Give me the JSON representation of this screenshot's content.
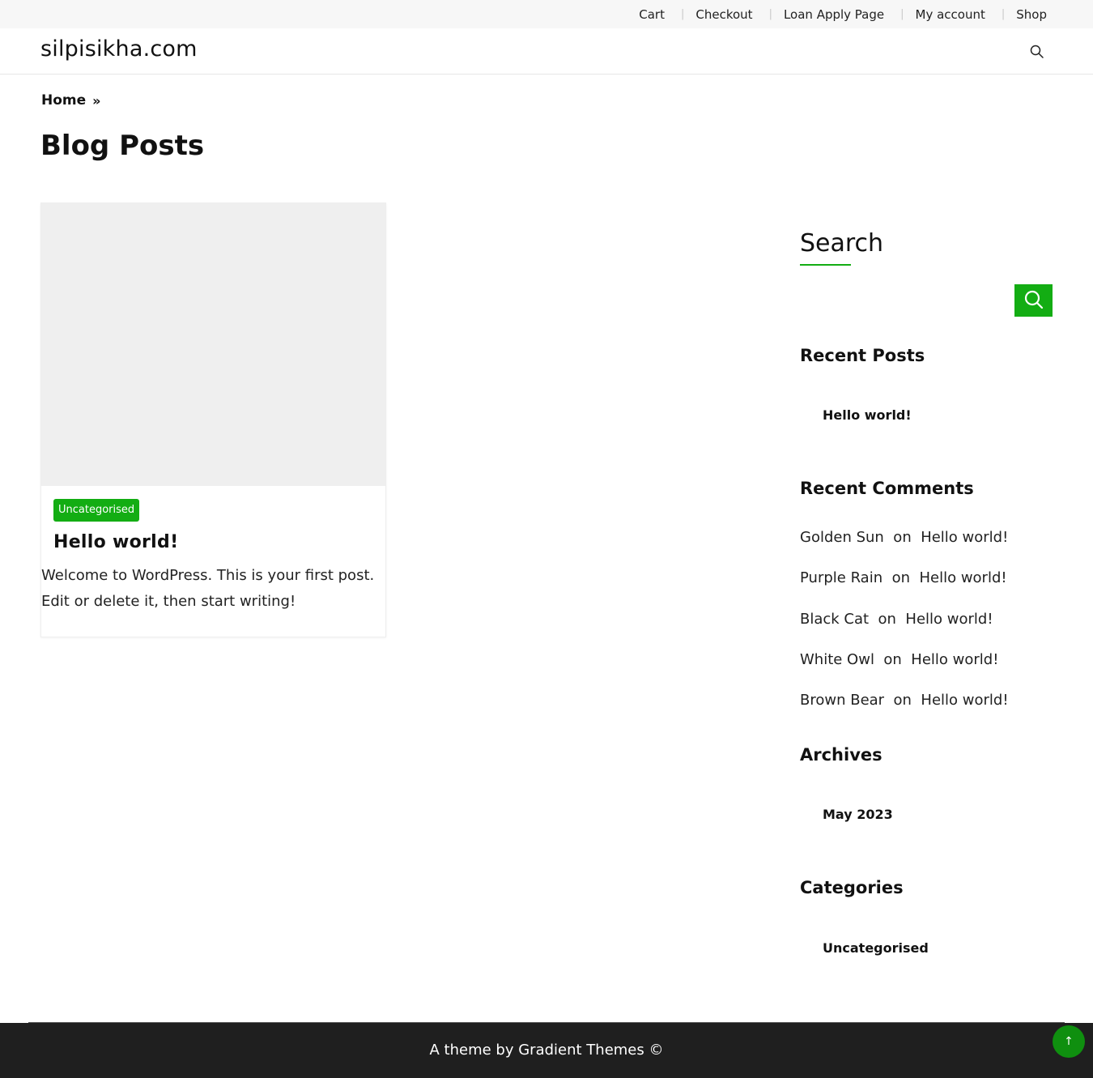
{
  "topnav": {
    "items": [
      "Cart",
      "Checkout",
      "Loan Apply Page",
      "My account",
      "Shop"
    ],
    "separator": "|"
  },
  "header": {
    "site_title": "silpisikha.com",
    "search_icon": "search-icon"
  },
  "breadcrumb": {
    "home": "Home",
    "chevron": "»"
  },
  "page": {
    "title": "Blog Posts"
  },
  "post": {
    "category": "Uncategorised",
    "title": "Hello world!",
    "excerpt": "Welcome to WordPress. This is your first post. Edit or delete it, then start writing!"
  },
  "sidebar": {
    "search_title": "Search",
    "search_placeholder": "",
    "recent_posts_title": "Recent Posts",
    "recent_posts": [
      "Hello world!"
    ],
    "recent_comments_title": "Recent Comments",
    "recent_comments": [
      {
        "author": "Golden Sun",
        "on": "on",
        "post": "Hello world!"
      },
      {
        "author": "Purple Rain",
        "on": "on",
        "post": "Hello world!"
      },
      {
        "author": "Black Cat",
        "on": "on",
        "post": "Hello world!"
      },
      {
        "author": "White Owl",
        "on": "on",
        "post": "Hello world!"
      },
      {
        "author": "Brown Bear",
        "on": "on",
        "post": "Hello world!"
      }
    ],
    "archives_title": "Archives",
    "archives": [
      "May 2023"
    ],
    "categories_title": "Categories",
    "categories": [
      "Uncategorised"
    ]
  },
  "footer": {
    "credit": "A theme by Gradient Themes ©",
    "back_to_top_icon": "↑"
  },
  "colors": {
    "accent": "#13ad13",
    "footer_bg": "#1f1f1f",
    "topbar_bg": "#f7f7f7"
  }
}
